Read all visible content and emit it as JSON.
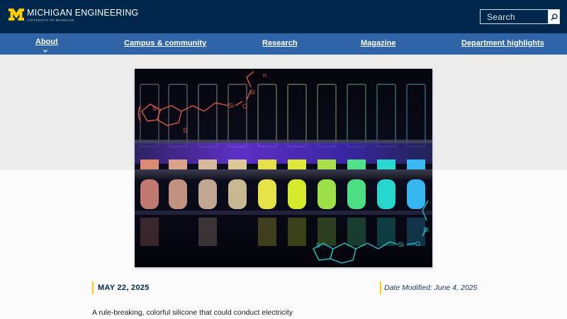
{
  "header": {
    "brand_title": "MICHIGAN ENGINEERING",
    "brand_subtitle": "UNIVERSITY OF MICHIGAN",
    "logo_icon": "block-m-logo",
    "search": {
      "placeholder": "Search",
      "button_icon": "search-icon"
    }
  },
  "nav": {
    "items": [
      {
        "label": "About"
      },
      {
        "label": "Campus & community"
      },
      {
        "label": "Research"
      },
      {
        "label": "Magazine"
      },
      {
        "label": "Department highlights"
      }
    ],
    "about_icon": "chevron-down-icon"
  },
  "hero": {
    "image": "test-tubes-glowing-colorful-silicone",
    "overlay_label": "n",
    "chemistry_labels": [
      "S",
      "S",
      "Si",
      "O",
      "Si",
      "S",
      "Si",
      "O",
      "Si"
    ]
  },
  "article": {
    "date": "MAY 22, 2025",
    "date_modified": "Date Modified: June 4, 2025",
    "headline": "A rule-breaking, colorful silicone that could conduct electricity"
  },
  "colors": {
    "navy": "#00274c",
    "nav_blue": "#2f65a7",
    "maize": "#ffcb05"
  }
}
